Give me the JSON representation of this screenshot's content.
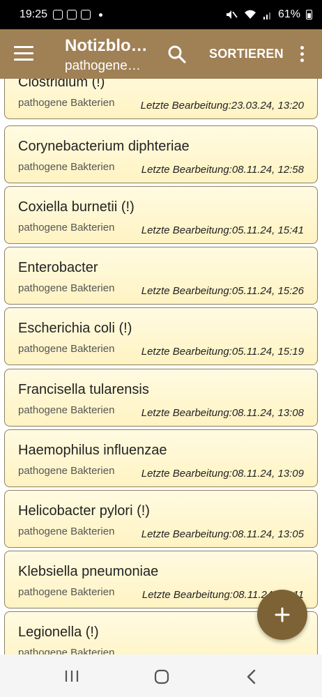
{
  "status_bar": {
    "time": "19:25",
    "battery": "61%"
  },
  "app_bar": {
    "title": "Notizblo…",
    "subtitle": "pathogene…",
    "sort_label": "SORTIEREN"
  },
  "notes": [
    {
      "title": "Clostridium (!)",
      "category": "pathogene Bakterien",
      "edited": "Letzte Bearbeitung:23.03.24, 13:20"
    },
    {
      "title": "Corynebacterium diphteriae",
      "category": "pathogene Bakterien",
      "edited": "Letzte Bearbeitung:08.11.24, 12:58"
    },
    {
      "title": "Coxiella burnetii (!)",
      "category": "pathogene Bakterien",
      "edited": "Letzte Bearbeitung:05.11.24, 15:41"
    },
    {
      "title": "Enterobacter",
      "category": "pathogene Bakterien",
      "edited": "Letzte Bearbeitung:05.11.24, 15:26"
    },
    {
      "title": "Escherichia coli (!)",
      "category": "pathogene Bakterien",
      "edited": "Letzte Bearbeitung:05.11.24, 15:19"
    },
    {
      "title": "Francisella tularensis",
      "category": "pathogene Bakterien",
      "edited": "Letzte Bearbeitung:08.11.24, 13:08"
    },
    {
      "title": "Haemophilus influenzae",
      "category": "pathogene Bakterien",
      "edited": "Letzte Bearbeitung:08.11.24, 13:09"
    },
    {
      "title": "Helicobacter pylori (!)",
      "category": "pathogene Bakterien",
      "edited": "Letzte Bearbeitung:08.11.24, 13:05"
    },
    {
      "title": "Klebsiella pneumoniae",
      "category": "pathogene Bakterien",
      "edited": "Letzte Bearbeitung:08.11.24, 13:11"
    },
    {
      "title": "Legionella (!)",
      "category": "pathogene Bakterien",
      "edited": ""
    }
  ],
  "colors": {
    "app_bar": "#a08055",
    "fab": "#7c6234",
    "card_top": "#fffbe2",
    "card_bottom": "#fff3c2"
  },
  "icons": {
    "menu": "hamburger-menu-icon",
    "search": "search-icon",
    "overflow": "more-vert-icon",
    "fab": "plus-icon",
    "nav": [
      "recents-icon",
      "home-icon",
      "back-icon"
    ]
  }
}
